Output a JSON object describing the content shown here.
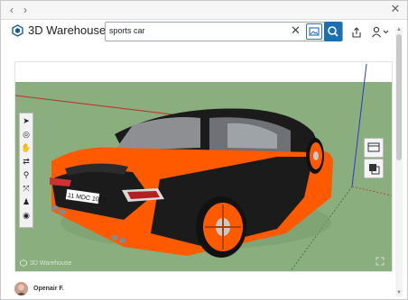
{
  "app": {
    "name": "3D Warehouse",
    "brand_color": "#1a6fb5"
  },
  "browser": {
    "back_icon": "chevron-left-icon",
    "forward_icon": "chevron-right-icon",
    "close_icon": "close-icon"
  },
  "search": {
    "value": "sports car",
    "clear_icon": "close-icon",
    "image_search_icon": "image-icon",
    "search_icon": "search-icon"
  },
  "header_actions": {
    "share_icon": "share-icon",
    "user_icon": "user-icon",
    "dropdown_icon": "chevron-down-icon"
  },
  "viewer": {
    "watermark": "3D Warehouse",
    "license_plate": "11 MDC 1023",
    "tools": [
      "select-icon",
      "orbit-icon",
      "pan-icon",
      "walk-icon",
      "zoom-icon",
      "zoom-extents-icon",
      "look-around-icon",
      "section-icon"
    ],
    "side_buttons": [
      "scenes-icon",
      "styles-icon"
    ],
    "expand_icon": "fullscreen-icon"
  },
  "author": {
    "name": "Openair F."
  },
  "colors": {
    "car_body": "#ff5a00",
    "car_dark": "#1b1b1b",
    "ground": "#8aae7d"
  }
}
